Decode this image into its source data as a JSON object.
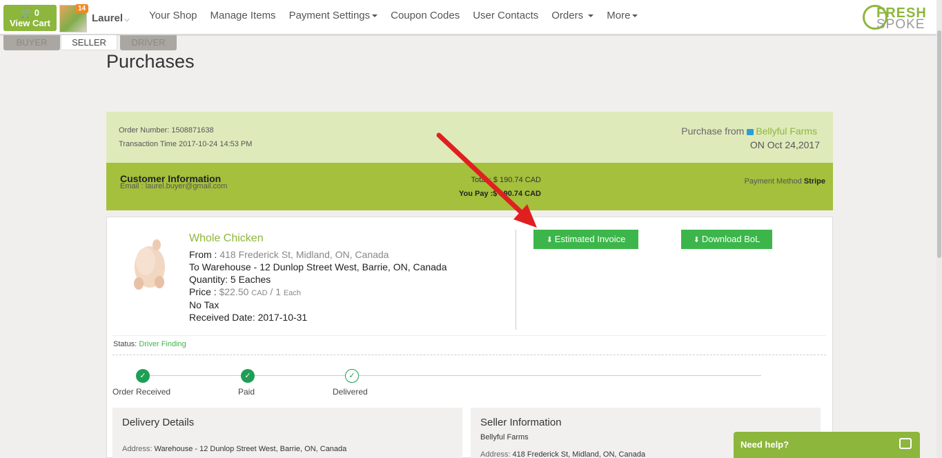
{
  "cart": {
    "count": "0",
    "label": "View Cart"
  },
  "user": {
    "badge": "14",
    "name": "Laurel"
  },
  "nav": [
    {
      "label": "Your Shop",
      "dropdown": false
    },
    {
      "label": "Manage Items",
      "dropdown": false
    },
    {
      "label": "Payment Settings",
      "dropdown": true
    },
    {
      "label": "Coupon Codes",
      "dropdown": false
    },
    {
      "label": "User Contacts",
      "dropdown": false
    },
    {
      "label": "Orders",
      "dropdown": true
    },
    {
      "label": "More",
      "dropdown": true
    }
  ],
  "logo": {
    "word1": "FRESH",
    "word2": "SPOKE"
  },
  "roles": {
    "buyer": "BUYER",
    "seller": "SELLER",
    "driver": "DRIVER"
  },
  "page": {
    "title": "Purchases"
  },
  "order": {
    "number": "Order Number: 1508871638",
    "transaction_time": "Transaction Time 2017-10-24 14:53 PM",
    "purchase_from_label": "Purchase from",
    "seller_name": "Bellyful Farms",
    "date": "ON Oct 24,2017"
  },
  "customer": {
    "title": "Customer Information",
    "email": "Email : laurel.buyer@gmail.com",
    "total": "Total : $ 190.74 CAD",
    "you_pay": "You Pay  :$ 190.74 CAD",
    "payment_method_label": "Payment Method",
    "payment_method": "Stripe"
  },
  "item": {
    "name": "Whole Chicken",
    "from_label": "From :",
    "from": "418 Frederick St, Midland, ON, Canada",
    "to": "To Warehouse - 12 Dunlop Street West, Barrie, ON, Canada",
    "quantity": "Quantity: 5 Eaches",
    "price_label": "Price :",
    "price": "$22.50",
    "currency": "CAD",
    "per": "/ 1",
    "unit": "Each",
    "tax": "No Tax",
    "received": "Received Date: 2017-10-31"
  },
  "buttons": {
    "invoice": "Estimated Invoice",
    "bol": "Download BoL"
  },
  "status": {
    "label": "Status:",
    "value": "Driver Finding"
  },
  "steps": [
    {
      "label": "Order Received",
      "done": true
    },
    {
      "label": "Paid",
      "done": true
    },
    {
      "label": "Delivered",
      "done": false
    }
  ],
  "delivery": {
    "title": "Delivery Details",
    "address_label": "Address:",
    "address": "Warehouse - 12 Dunlop Street West, Barrie, ON, Canada"
  },
  "seller": {
    "title": "Seller Information",
    "name": "Bellyful Farms",
    "address_label": "Address:",
    "address": "418 Frederick St, Midland, ON, Canada"
  },
  "help": {
    "label": "Need help?"
  },
  "colors": {
    "brand_green": "#8db63c",
    "button_green": "#3cb64a",
    "bar_green": "#a4c03c",
    "header_green": "#dfeabb"
  }
}
